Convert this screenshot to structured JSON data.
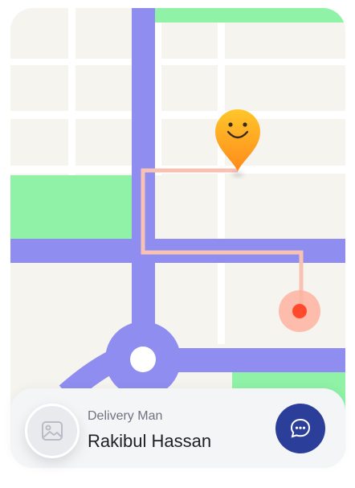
{
  "colors": {
    "road": "#8f8ef0",
    "park": "#8ff2a6",
    "block": "#f5f4ef",
    "street": "#ffffff",
    "route": "#f7c1b4",
    "courier_pin_top": "#ffc62a",
    "courier_pin_bottom": "#ff8a1c",
    "destination_dot": "#ff4b2b",
    "chat_button": "#2b3e99"
  },
  "delivery": {
    "role_label": "Delivery Man",
    "name": "Rakibul Hassan",
    "avatar_icon": "image-placeholder-icon",
    "chat_icon": "chat-bubble-icon"
  },
  "map": {
    "courier_icon": "smiley-location-pin-icon",
    "destination_icon": "destination-dot-icon"
  }
}
